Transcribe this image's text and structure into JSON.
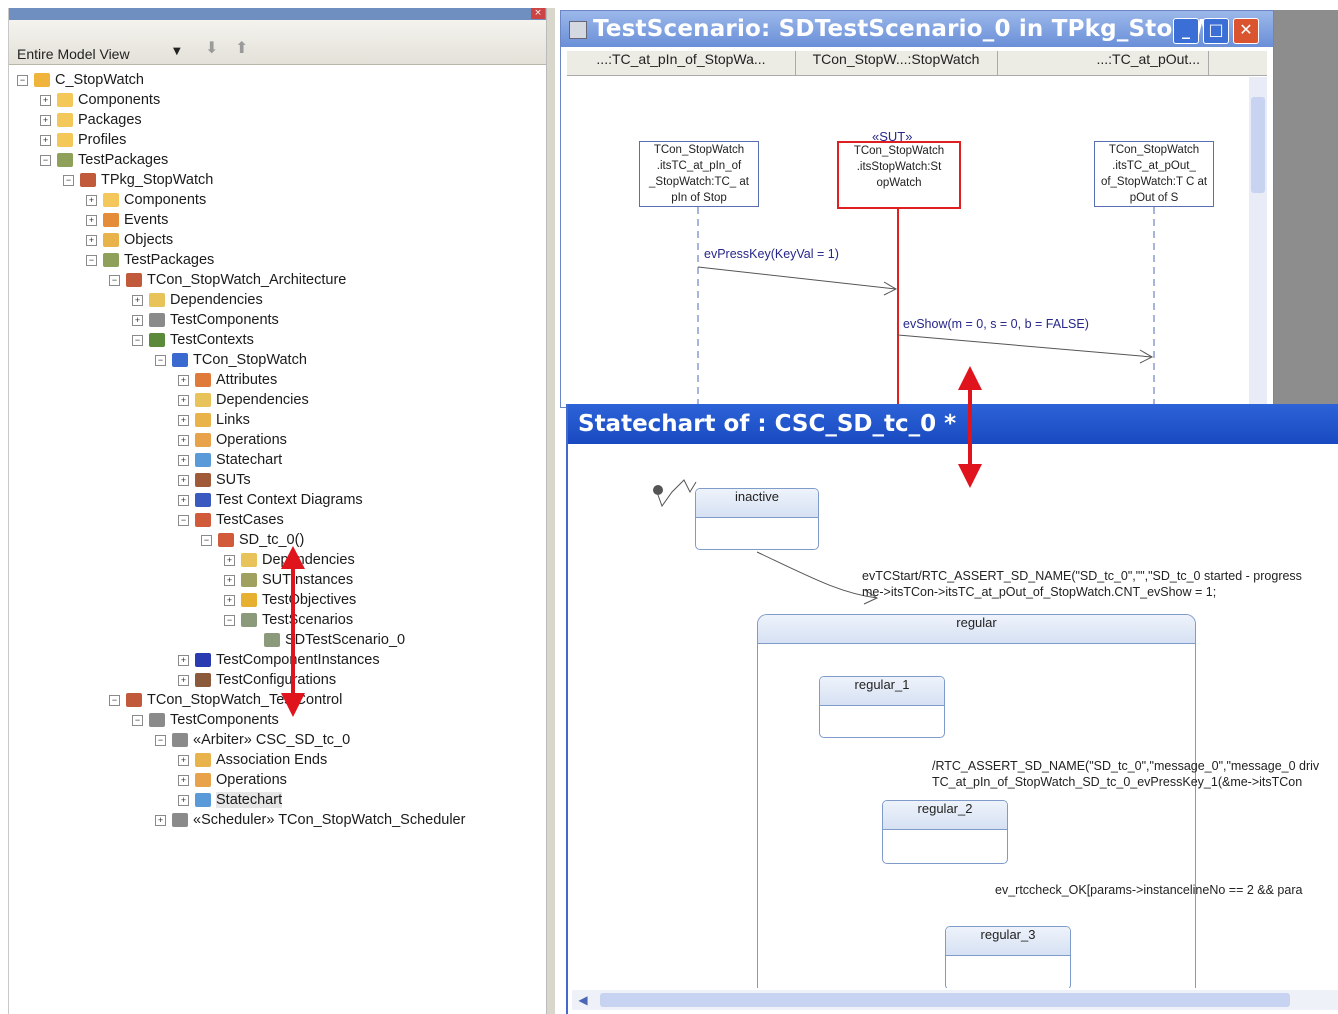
{
  "browser": {
    "view_select": "Entire Model View",
    "tree": [
      {
        "label": "C_StopWatch",
        "depth": 0,
        "exp": "-",
        "icon": "folder",
        "color": "#f0b43c"
      },
      {
        "label": "Components",
        "depth": 1,
        "exp": "+",
        "icon": "folder",
        "color": "#f3c75a"
      },
      {
        "label": "Packages",
        "depth": 1,
        "exp": "+",
        "icon": "folder",
        "color": "#f3c75a"
      },
      {
        "label": "Profiles",
        "depth": 1,
        "exp": "+",
        "icon": "folder",
        "color": "#f3c75a"
      },
      {
        "label": "TestPackages",
        "depth": 1,
        "exp": "-",
        "icon": "package",
        "color": "#8fa05a"
      },
      {
        "label": "TPkg_StopWatch",
        "depth": 2,
        "exp": "-",
        "icon": "package",
        "color": "#c05a3a"
      },
      {
        "label": "Components",
        "depth": 3,
        "exp": "+",
        "icon": "folder",
        "color": "#f3c75a"
      },
      {
        "label": "Events",
        "depth": 3,
        "exp": "+",
        "icon": "events",
        "color": "#e58c3a"
      },
      {
        "label": "Objects",
        "depth": 3,
        "exp": "+",
        "icon": "objects",
        "color": "#e8b34a"
      },
      {
        "label": "TestPackages",
        "depth": 3,
        "exp": "-",
        "icon": "package",
        "color": "#8fa05a"
      },
      {
        "label": "TCon_StopWatch_Architecture",
        "depth": 4,
        "exp": "-",
        "icon": "package",
        "color": "#c05a3a"
      },
      {
        "label": "Dependencies",
        "depth": 5,
        "exp": "+",
        "icon": "dependencies",
        "color": "#e8c35a"
      },
      {
        "label": "TestComponents",
        "depth": 5,
        "exp": "+",
        "icon": "component",
        "color": "#8a8a8a"
      },
      {
        "label": "TestContexts",
        "depth": 5,
        "exp": "-",
        "icon": "context",
        "color": "#5a8a3a"
      },
      {
        "label": "TCon_StopWatch",
        "depth": 6,
        "exp": "-",
        "icon": "context",
        "color": "#3a6ad0"
      },
      {
        "label": "Attributes",
        "depth": 7,
        "exp": "+",
        "icon": "attributes",
        "color": "#e07a3a"
      },
      {
        "label": "Dependencies",
        "depth": 7,
        "exp": "+",
        "icon": "dependencies",
        "color": "#e8c35a"
      },
      {
        "label": "Links",
        "depth": 7,
        "exp": "+",
        "icon": "links",
        "color": "#e8b34a"
      },
      {
        "label": "Operations",
        "depth": 7,
        "exp": "+",
        "icon": "operations",
        "color": "#e8a34a"
      },
      {
        "label": "Statechart",
        "depth": 7,
        "exp": "+",
        "icon": "statechart",
        "color": "#5a9ad8"
      },
      {
        "label": "SUTs",
        "depth": 7,
        "exp": "+",
        "icon": "suts",
        "color": "#a05a3a"
      },
      {
        "label": "Test Context Diagrams",
        "depth": 7,
        "exp": "+",
        "icon": "diagram",
        "color": "#3a5ac0"
      },
      {
        "label": "TestCases",
        "depth": 7,
        "exp": "-",
        "icon": "testcase",
        "color": "#d05a3a"
      },
      {
        "label": "SD_tc_0()",
        "depth": 8,
        "exp": "-",
        "icon": "testcase",
        "color": "#d05a3a"
      },
      {
        "label": "Dependencies",
        "depth": 9,
        "exp": "+",
        "icon": "dependencies",
        "color": "#e8c35a"
      },
      {
        "label": "SUTInstances",
        "depth": 9,
        "exp": "+",
        "icon": "suts",
        "color": "#a0a060"
      },
      {
        "label": "TestObjectives",
        "depth": 9,
        "exp": "+",
        "icon": "objectives",
        "color": "#e8b030"
      },
      {
        "label": "TestScenarios",
        "depth": 9,
        "exp": "-",
        "icon": "scenario",
        "color": "#8a9a7a"
      },
      {
        "label": "SDTestScenario_0",
        "depth": 10,
        "exp": "none",
        "icon": "scenario",
        "color": "#8a9a7a"
      },
      {
        "label": "TestComponentInstances",
        "depth": 7,
        "exp": "+",
        "icon": "instances",
        "color": "#2a3ab0"
      },
      {
        "label": "TestConfigurations",
        "depth": 7,
        "exp": "+",
        "icon": "config",
        "color": "#8a5a3a"
      },
      {
        "label": "TCon_StopWatch_TestControl",
        "depth": 4,
        "exp": "-",
        "icon": "package",
        "color": "#c05a3a"
      },
      {
        "label": "TestComponents",
        "depth": 5,
        "exp": "-",
        "icon": "component",
        "color": "#8a8a8a"
      },
      {
        "label": "«Arbiter» CSC_SD_tc_0",
        "depth": 6,
        "exp": "-",
        "icon": "component",
        "color": "#8a8a8a"
      },
      {
        "label": "Association Ends",
        "depth": 7,
        "exp": "+",
        "icon": "links",
        "color": "#e8b34a"
      },
      {
        "label": "Operations",
        "depth": 7,
        "exp": "+",
        "icon": "operations",
        "color": "#e8a34a"
      },
      {
        "label": "Statechart",
        "depth": 7,
        "exp": "+",
        "icon": "statechart",
        "color": "#5a9ad8",
        "selected": true
      },
      {
        "label": "«Scheduler» TCon_StopWatch_Scheduler",
        "depth": 6,
        "exp": "+",
        "icon": "component",
        "color": "#8a8a8a"
      }
    ]
  },
  "sd_window": {
    "title": "TestScenario: SDTestScenario_0 in TPkg_StopW...",
    "headers": [
      "...:TC_at_pIn_of_StopWa...",
      "TCon_StopW...:StopWatch",
      "...:TC_at_pOut..."
    ],
    "sut_stereotype": "«SUT»",
    "lifelines": [
      {
        "text": "TCon_StopWatch .itsTC_at_pIn_of _StopWatch:TC_ at pIn of Stop"
      },
      {
        "text": "TCon_StopWatch .itsStopWatch:St opWatch"
      },
      {
        "text": "TCon_StopWatch .itsTC_at_pOut_ of_StopWatch:T C at pOut of S"
      }
    ],
    "messages": [
      "evPressKey(KeyVal = 1)",
      "evShow(m = 0, s = 0, b = FALSE)"
    ],
    "sut_color": "#e02020"
  },
  "sc_window": {
    "title": "Statechart of : CSC_SD_tc_0 *",
    "states": {
      "inactive": "inactive",
      "regular": "regular",
      "regular_1": "regular_1",
      "regular_2": "regular_2",
      "regular_3": "regular_3"
    },
    "transitions": {
      "t1_line1": "evTCStart/RTC_ASSERT_SD_NAME(\"SD_tc_0\",\"\",\"SD_tc_0 started - progress",
      "t1_line2": "me->itsTCon->itsTC_at_pOut_of_StopWatch.CNT_evShow = 1;",
      "t2_line1": "/RTC_ASSERT_SD_NAME(\"SD_tc_0\",\"message_0\",\"message_0 driv",
      "t2_line2": "TC_at_pIn_of_StopWatch_SD_tc_0_evPressKey_1(&me->itsTCon",
      "t3_line1": "ev_rtccheck_OK[params->instancelineNo == 2 && para"
    }
  },
  "annotation_color": "#e0141c"
}
